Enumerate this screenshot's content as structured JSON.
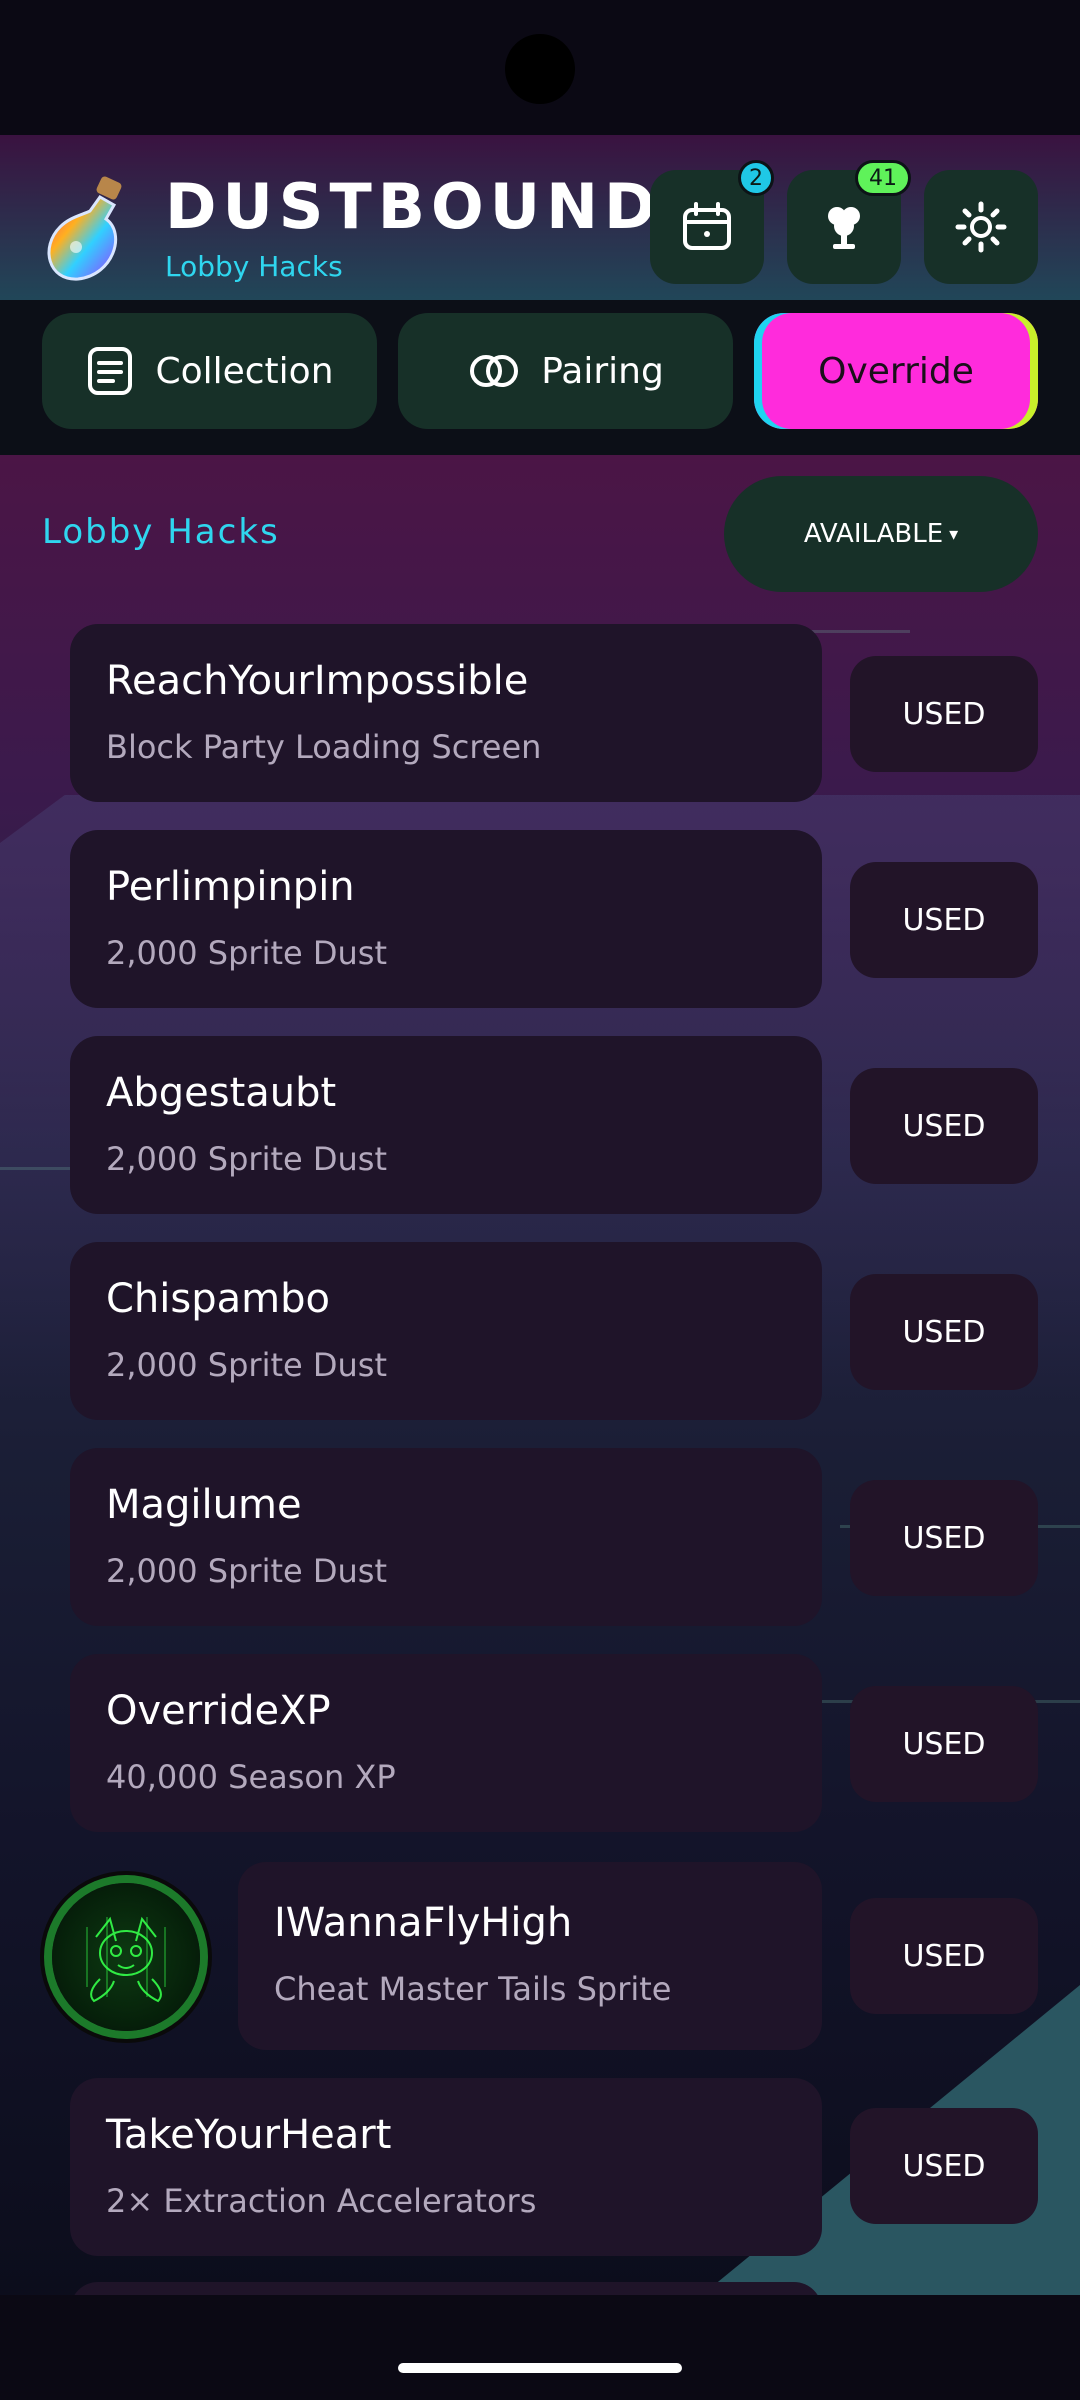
{
  "header": {
    "title": "DUSTBOUND",
    "subtitle": "Lobby Hacks",
    "calendar_badge": "2",
    "tree_badge": "41"
  },
  "tabs": [
    {
      "label": "Collection",
      "icon": "list-icon",
      "active": false
    },
    {
      "label": "Pairing",
      "icon": "rings-icon",
      "active": false
    },
    {
      "label": "Override",
      "icon": "",
      "active": true
    }
  ],
  "section": {
    "title": "Lobby Hacks",
    "filter_label": "AVAILABLE",
    "filter_arrow": "▾"
  },
  "codes": [
    {
      "code": "ReachYourImpossible",
      "reward": "Block Party Loading Screen",
      "status": "USED"
    },
    {
      "code": "Perlimpinpin",
      "reward": "2,000 Sprite Dust",
      "status": "USED"
    },
    {
      "code": "Abgestaubt",
      "reward": "2,000 Sprite Dust",
      "status": "USED"
    },
    {
      "code": "Chispambo",
      "reward": "2,000 Sprite Dust",
      "status": "USED"
    },
    {
      "code": "Magilume",
      "reward": "2,000 Sprite Dust",
      "status": "USED"
    },
    {
      "code": "OverrideXP",
      "reward": "40,000 Season XP",
      "status": "USED"
    },
    {
      "code": "IWannaFlyHigh",
      "reward": "Cheat Master Tails Sprite",
      "status": "USED",
      "avatar": true
    },
    {
      "code": "TakeYourHeart",
      "reward": "2× Extraction Accelerators",
      "status": "USED"
    }
  ],
  "colors": {
    "accent_cyan": "#2fd6ef",
    "accent_pink": "#ff2bdc",
    "accent_lime": "#c8f02a",
    "button_green": "#173028",
    "card_bg": "#1f1429"
  }
}
